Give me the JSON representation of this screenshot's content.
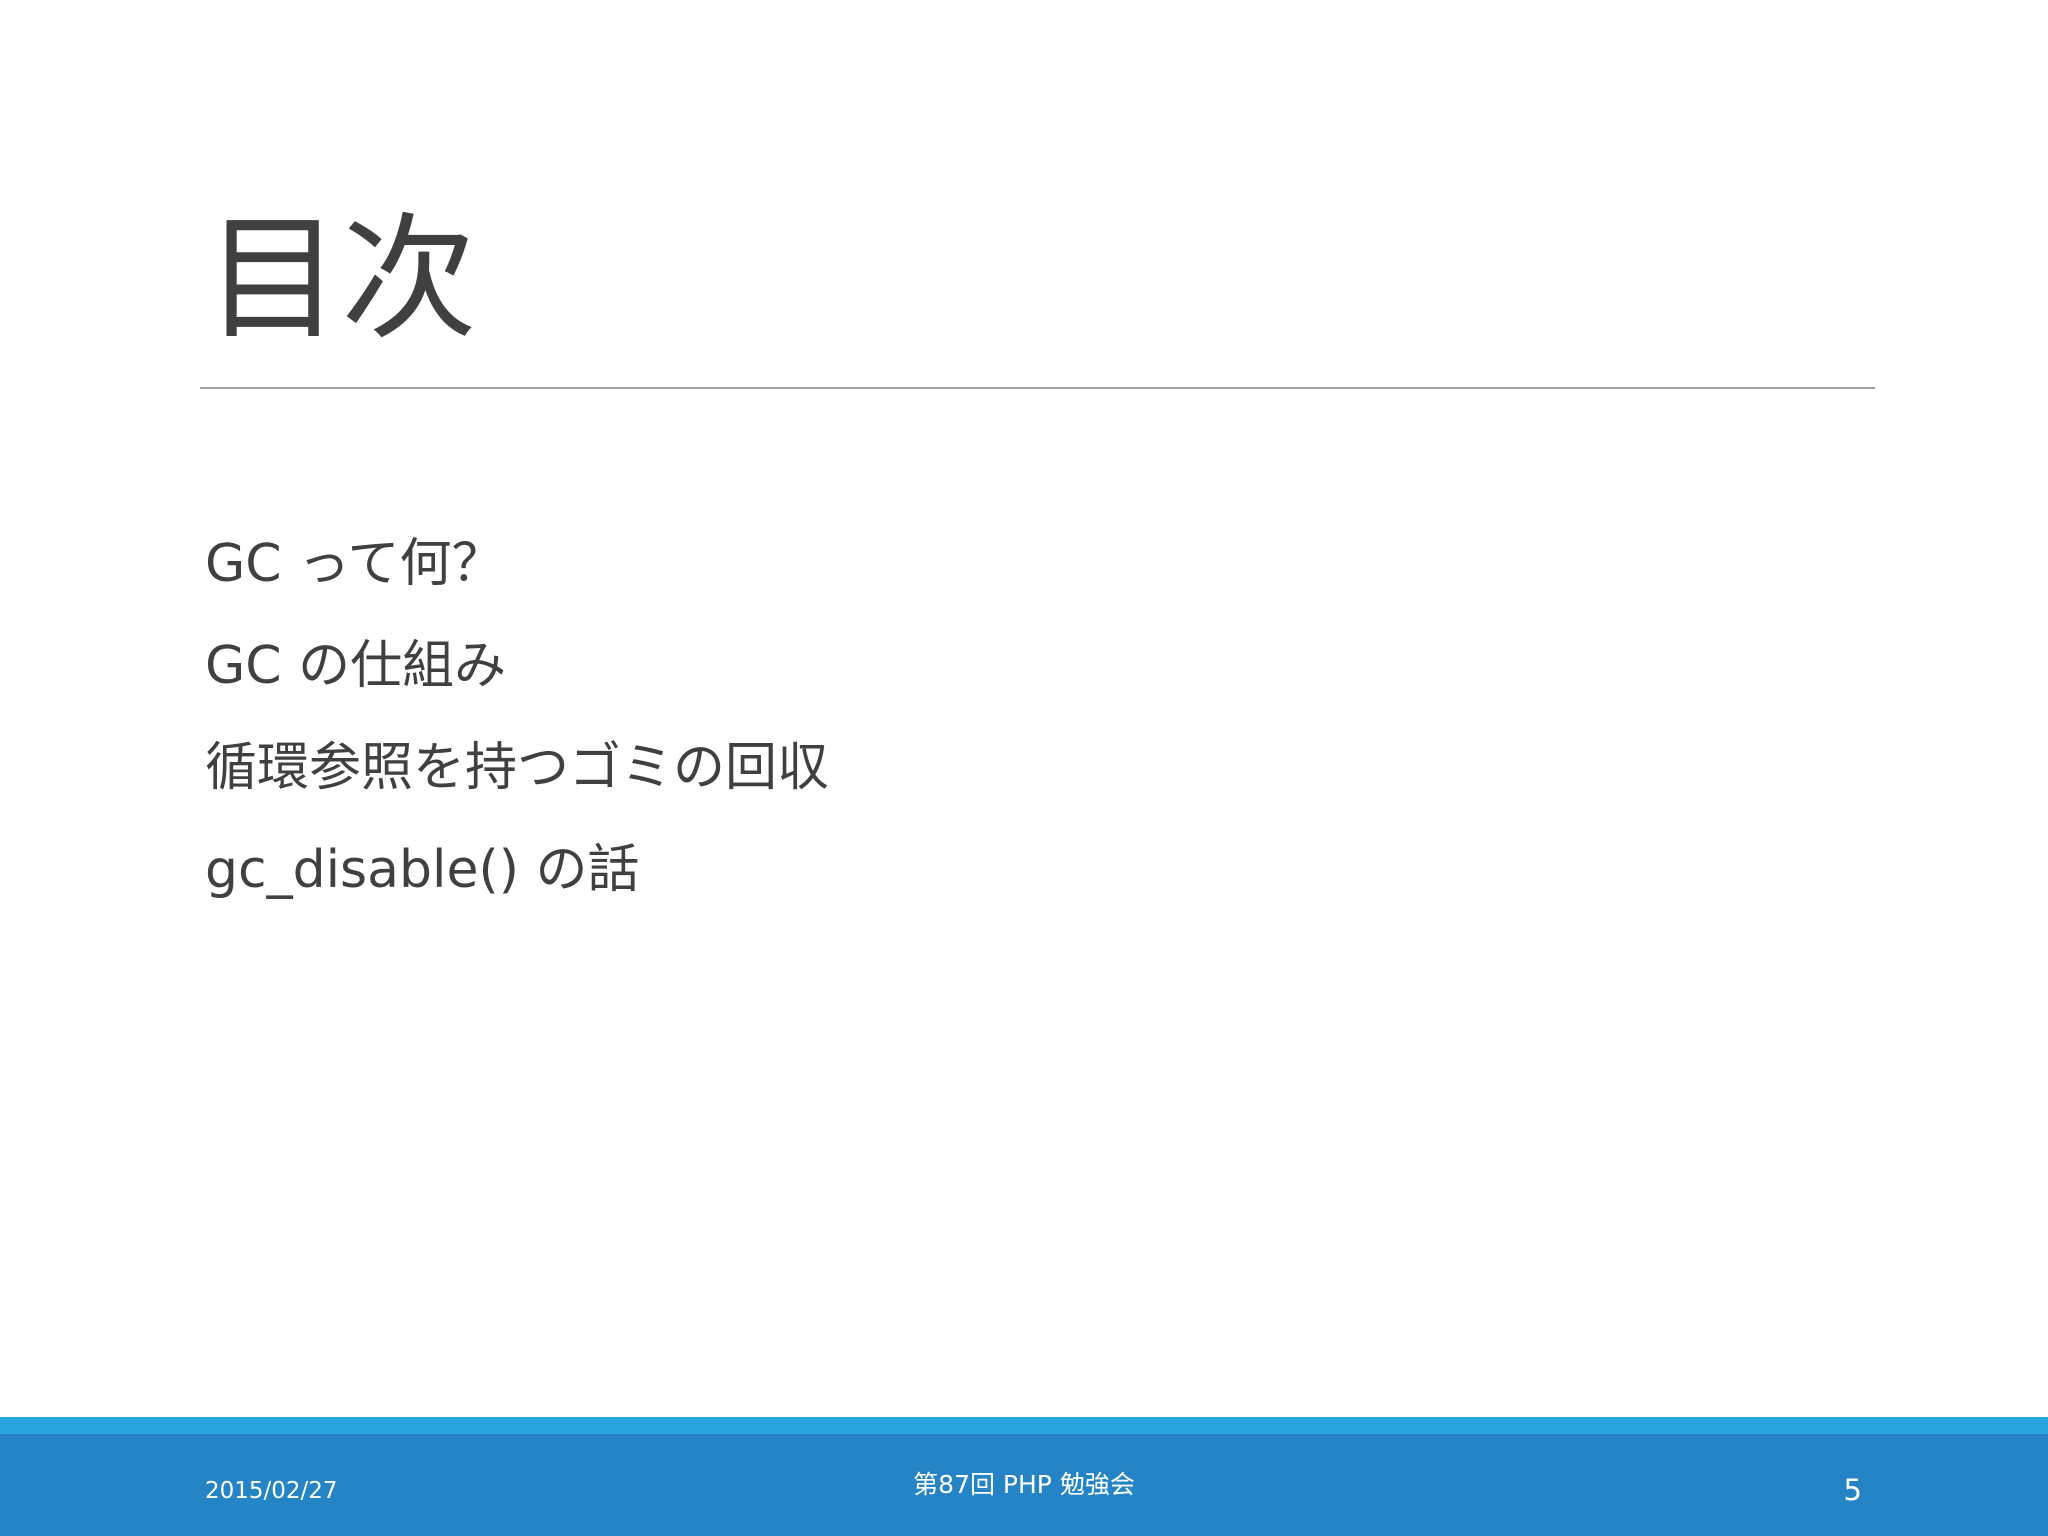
{
  "slide": {
    "title": "目次",
    "items": [
      {
        "label": "GC って何？"
      },
      {
        "label": "GC の仕組み"
      },
      {
        "label": "循環参照を持つゴミの回収"
      },
      {
        "label": "gc_disable() の話"
      }
    ]
  },
  "footer": {
    "date": "2015/02/27",
    "event": "第87回 PHP 勉強会",
    "page_number": "5"
  },
  "colors": {
    "text": "#404040",
    "divider": "#a0a0a0",
    "footer_accent": "#27a3dd",
    "footer_bar": "#2584c6"
  }
}
